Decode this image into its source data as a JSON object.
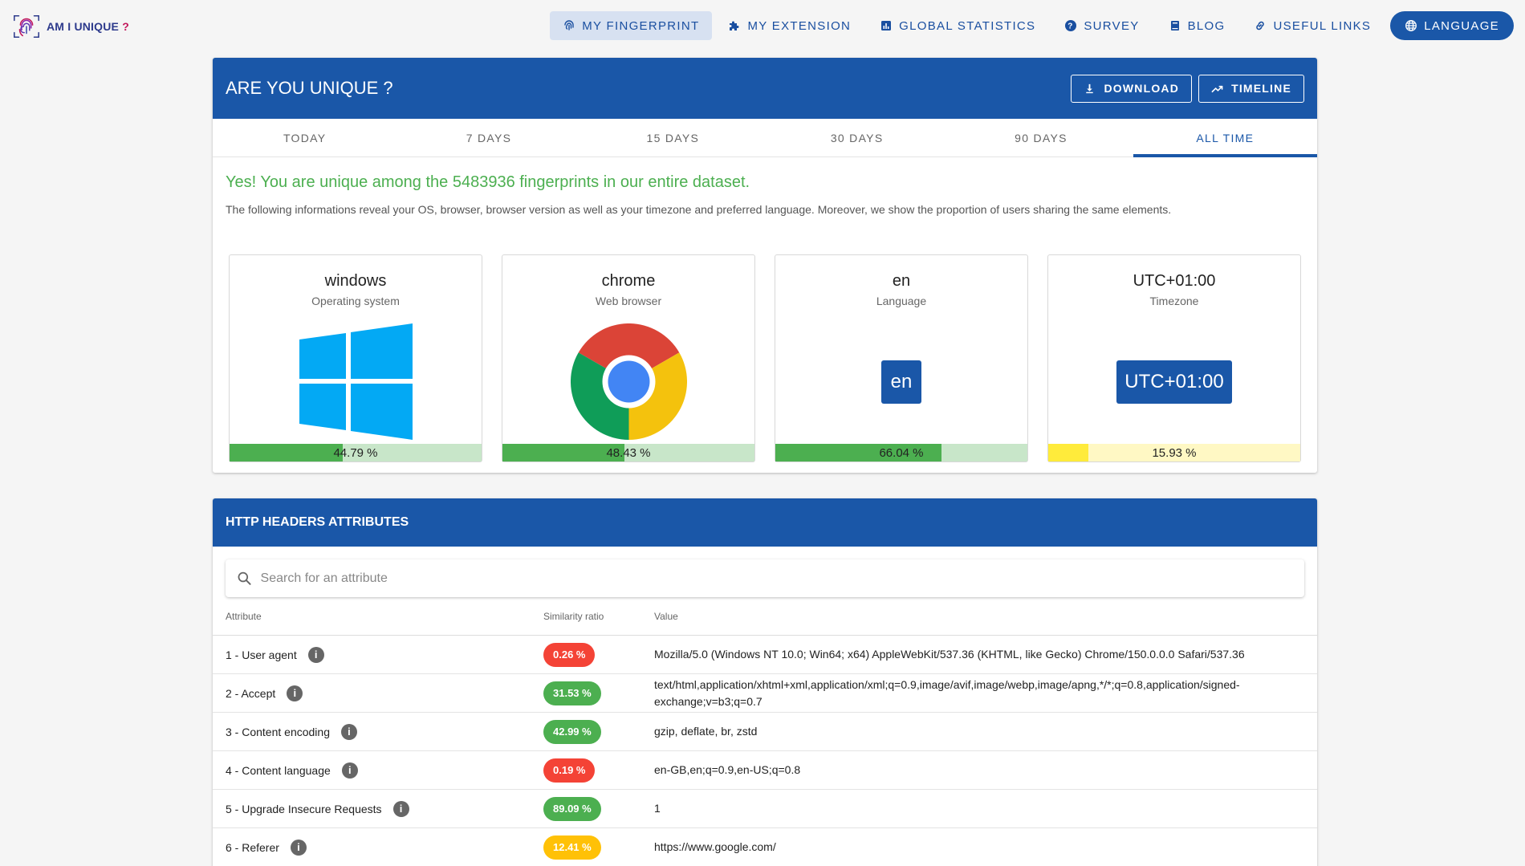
{
  "nav": {
    "logo_text": "AM I UNIQUE",
    "logo_q": "?",
    "items": [
      {
        "label": "MY FINGERPRINT",
        "icon": "fingerprint-icon"
      },
      {
        "label": "MY EXTENSION",
        "icon": "puzzle-icon"
      },
      {
        "label": "GLOBAL STATISTICS",
        "icon": "bar-chart-icon"
      },
      {
        "label": "SURVEY",
        "icon": "help-circle-icon"
      },
      {
        "label": "BLOG",
        "icon": "book-icon"
      },
      {
        "label": "USEFUL LINKS",
        "icon": "link-icon"
      }
    ],
    "language_label": "LANGUAGE",
    "accent": "#1a57a8"
  },
  "summary": {
    "title": "ARE YOU UNIQUE ?",
    "download_label": "DOWNLOAD",
    "timeline_label": "TIMELINE",
    "tabs": [
      "TODAY",
      "7 DAYS",
      "15 DAYS",
      "30 DAYS",
      "90 DAYS",
      "ALL TIME"
    ],
    "active_tab": "ALL TIME",
    "message": "Yes! You are unique among the 5483936 fingerprints in our entire dataset.",
    "description": "The following informations reveal your OS, browser, browser version as well as your timezone and preferred language. Moreover, we show the proportion of users sharing the same elements.",
    "tiles": [
      {
        "name": "windows",
        "subtitle": "Operating system",
        "percent_label": "44.79 %",
        "percent": 44.79,
        "visual": "windows-logo-icon",
        "bar_color": "#4caf50"
      },
      {
        "name": "chrome",
        "subtitle": "Web browser",
        "percent_label": "48.43 %",
        "percent": 48.43,
        "visual": "chrome-logo-icon",
        "bar_color": "#4caf50"
      },
      {
        "name": "en",
        "subtitle": "Language",
        "percent_label": "66.04 %",
        "percent": 66.04,
        "chip": "en",
        "bar_color": "#4caf50"
      },
      {
        "name": "UTC+01:00",
        "subtitle": "Timezone",
        "percent_label": "15.93 %",
        "percent": 15.93,
        "chip": "UTC+01:00",
        "bar_color": "#ffeb3b"
      }
    ]
  },
  "headers": {
    "title": "HTTP HEADERS ATTRIBUTES",
    "search_placeholder": "Search for an attribute",
    "columns": [
      "Attribute",
      "Similarity ratio",
      "Value"
    ],
    "rows": [
      {
        "attribute": "1 - User agent",
        "ratio": "0.26 %",
        "color": "#f44336",
        "value": "Mozilla/5.0 (Windows NT 10.0; Win64; x64) AppleWebKit/537.36 (KHTML, like Gecko) Chrome/150.0.0.0 Safari/537.36"
      },
      {
        "attribute": "2 - Accept",
        "ratio": "31.53 %",
        "color": "#4caf50",
        "value": "text/html,application/xhtml+xml,application/xml;q=0.9,image/avif,image/webp,image/apng,*/*;q=0.8,application/signed-exchange;v=b3;q=0.7"
      },
      {
        "attribute": "3 - Content encoding",
        "ratio": "42.99 %",
        "color": "#4caf50",
        "value": "gzip, deflate, br, zstd"
      },
      {
        "attribute": "4 - Content language",
        "ratio": "0.19 %",
        "color": "#f44336",
        "value": "en-GB,en;q=0.9,en-US;q=0.8"
      },
      {
        "attribute": "5 - Upgrade Insecure Requests",
        "ratio": "89.09 %",
        "color": "#4caf50",
        "value": "1"
      },
      {
        "attribute": "6 - Referer",
        "ratio": "12.41 %",
        "color": "#ffc107",
        "value": "https://www.google.com/"
      }
    ]
  }
}
